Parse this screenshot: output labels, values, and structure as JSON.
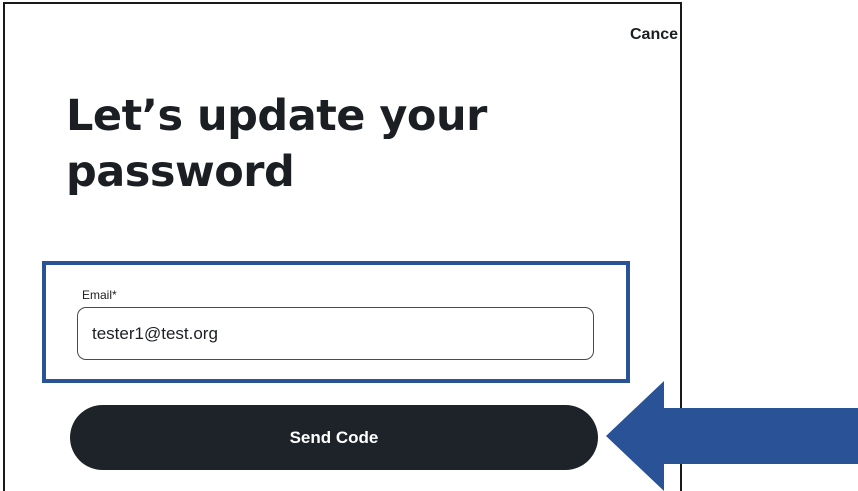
{
  "header": {
    "cancel_label": "Cance"
  },
  "main": {
    "title": "Let’s update your password"
  },
  "form": {
    "email_label": "Email*",
    "email_value": "tester1@test.org",
    "submit_label": "Send Code"
  },
  "annotation": {
    "highlight_color": "#2a5296",
    "arrow_color": "#2a5296",
    "arrow_icon": "arrow-left-icon"
  }
}
